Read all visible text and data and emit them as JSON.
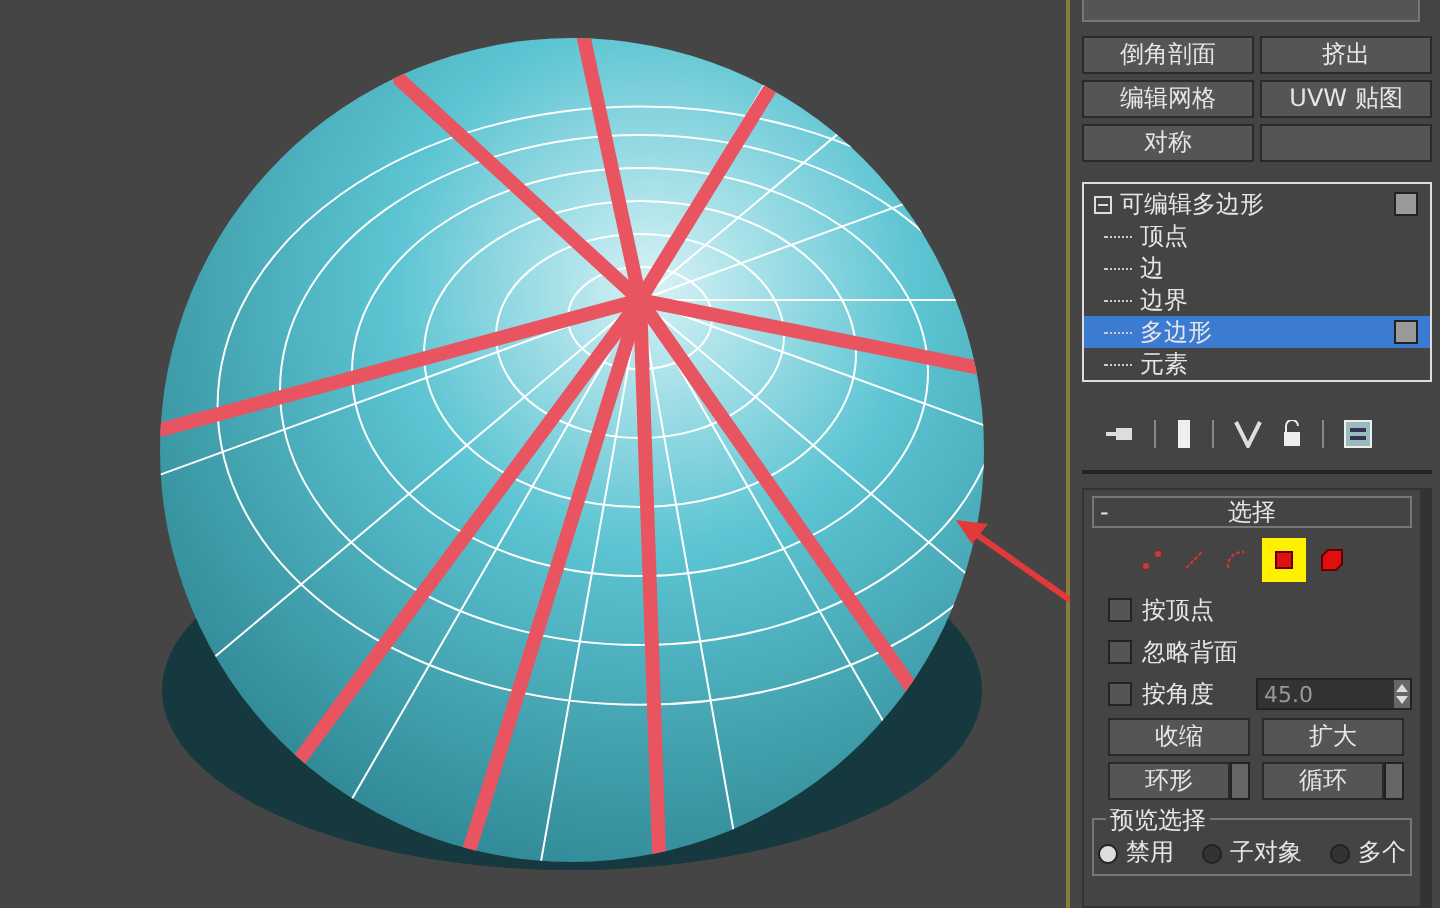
{
  "modifier_buttons": [
    "倒角剖面",
    "挤出",
    "编辑网格",
    "UVW 贴图",
    "对称"
  ],
  "stack": {
    "label": "可编辑多边形",
    "expanded": true,
    "children": [
      {
        "label": "顶点",
        "selected": false
      },
      {
        "label": "边",
        "selected": false
      },
      {
        "label": "边界",
        "selected": false
      },
      {
        "label": "多边形",
        "selected": true
      },
      {
        "label": "元素",
        "selected": false
      }
    ]
  },
  "rollout": {
    "collapse": "-",
    "title": "选择",
    "subobjects": [
      {
        "kind": "vertex",
        "selected": false
      },
      {
        "kind": "edge",
        "selected": false
      },
      {
        "kind": "border",
        "selected": false
      },
      {
        "kind": "polygon",
        "selected": true
      },
      {
        "kind": "element",
        "selected": false
      }
    ],
    "options": [
      {
        "label": "按顶点",
        "checked": false
      },
      {
        "label": "忽略背面",
        "checked": false
      },
      {
        "label": "按角度",
        "checked": false,
        "value": "45.0"
      }
    ],
    "shrink": "收缩",
    "grow": "扩大",
    "ring": "环形",
    "loop": "循环",
    "preview": {
      "title": "预览选择",
      "options": [
        {
          "label": "禁用",
          "selected": true
        },
        {
          "label": "子对象",
          "selected": false
        },
        {
          "label": "多个",
          "selected": false
        }
      ]
    }
  }
}
